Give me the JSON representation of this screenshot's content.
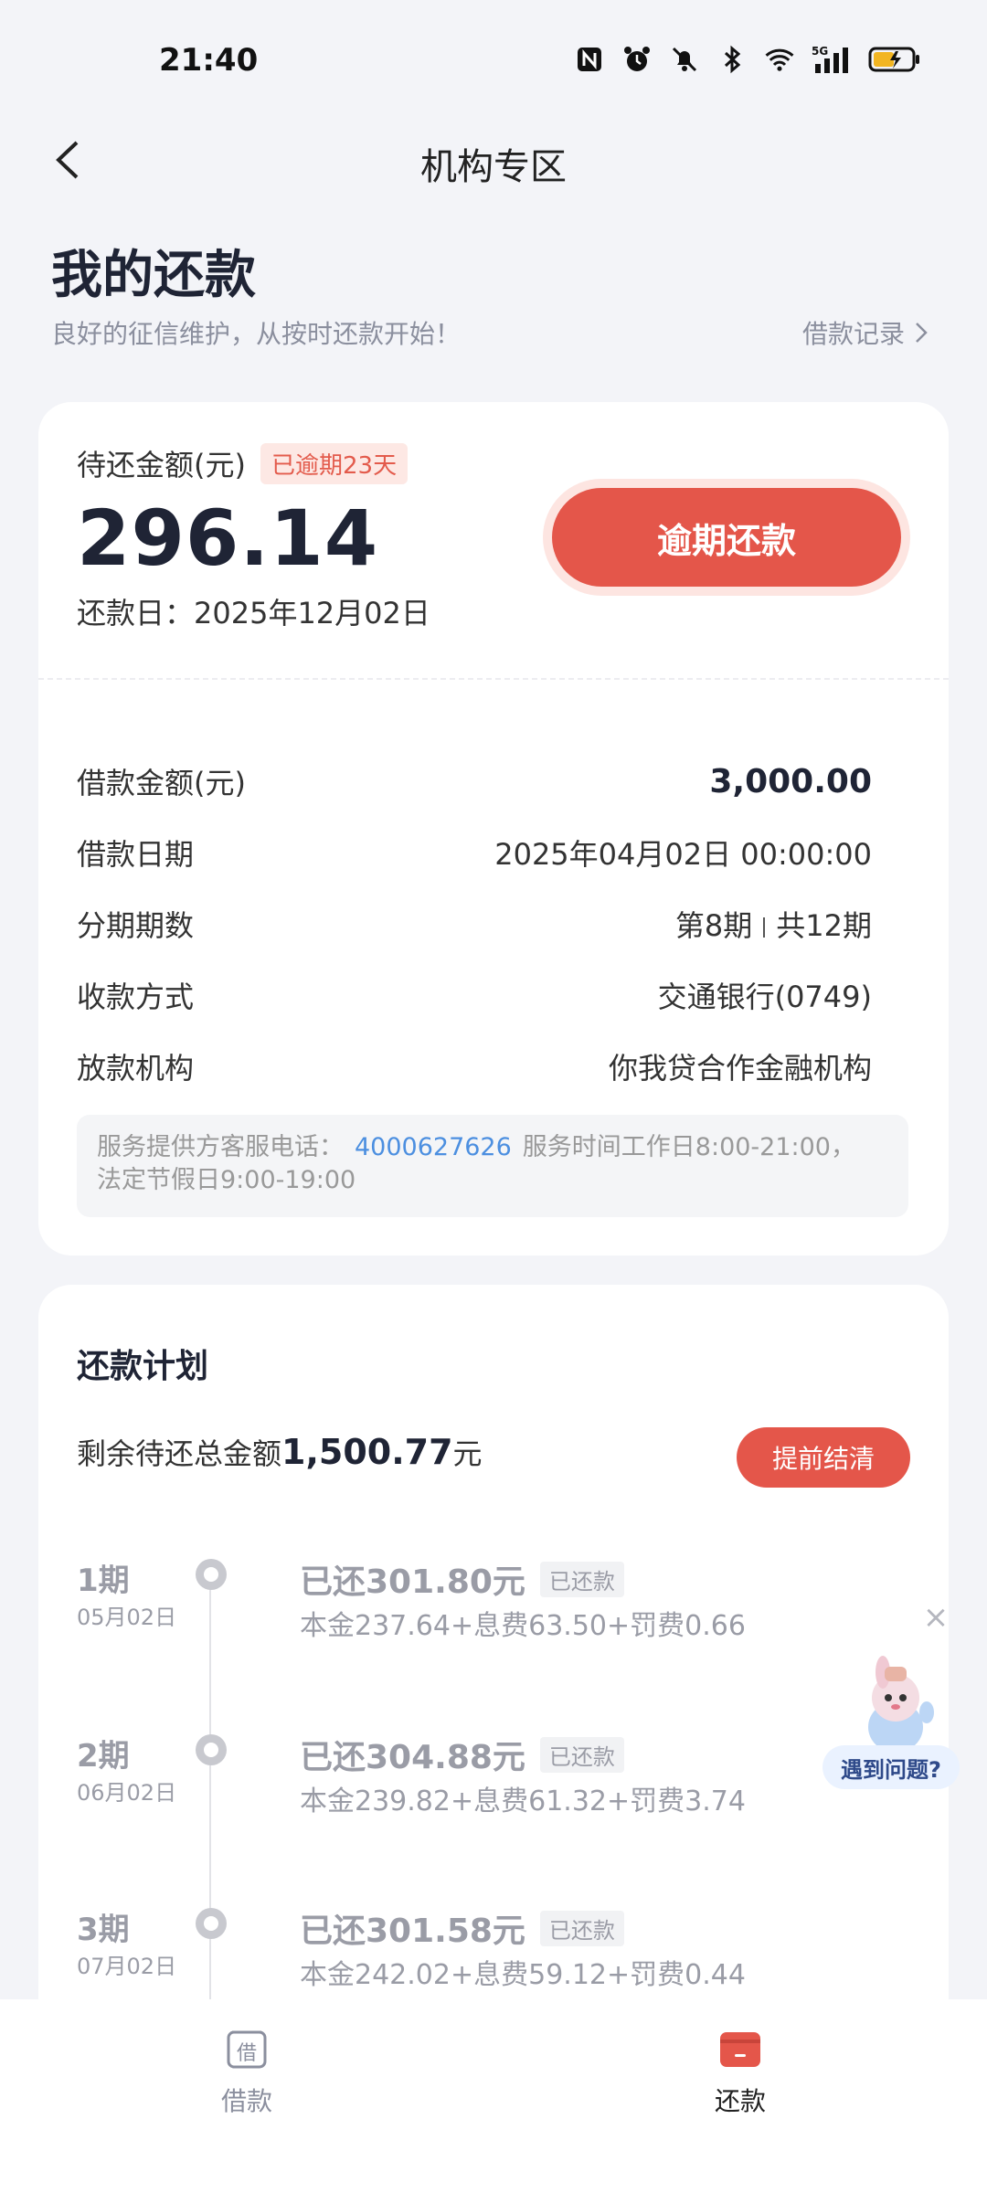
{
  "status_bar": {
    "time": "21:40",
    "network": "5G"
  },
  "header": {
    "title": "机构专区"
  },
  "page": {
    "title": "我的还款",
    "subtitle": "良好的征信维护，从按时还款开始！",
    "loan_records_link": "借款记录"
  },
  "summary": {
    "pending_label": "待还金额(元)",
    "overdue_badge": "已逾期23天",
    "pending_amount": "296.14",
    "due_date": "还款日：2025年12月02日",
    "overdue_button": "逾期还款"
  },
  "details": [
    {
      "label": "借款金额(元)",
      "value": "3,000.00"
    },
    {
      "label": "借款日期",
      "value": "2025年04月02日 00:00:00"
    },
    {
      "label": "分期期数",
      "value_current": "第8期",
      "value_total": "共12期"
    },
    {
      "label": "收款方式",
      "value": "交通银行(0749)"
    },
    {
      "label": "放款机构",
      "value": "你我贷合作金融机构"
    }
  ],
  "service": {
    "prefix": "服务提供方客服电话：",
    "phone": "4000627626",
    "hours": "服务时间工作日8:00-21:00，",
    "hours2": "法定节假日9:00-19:00"
  },
  "plan": {
    "title": "还款计划",
    "remaining_prefix": "剩余待还总金额",
    "remaining_amount": "1,500.77",
    "remaining_suffix": "元",
    "early_button": "提前结清",
    "periods": [
      {
        "num": "1期",
        "date": "05月02日",
        "paid": "已还301.80元",
        "tag": "已还款",
        "detail": "本金237.64+息费63.50+罚费0.66"
      },
      {
        "num": "2期",
        "date": "06月02日",
        "paid": "已还304.88元",
        "tag": "已还款",
        "detail": "本金239.82+息费61.32+罚费3.74"
      },
      {
        "num": "3期",
        "date": "07月02日",
        "paid": "已还301.58元",
        "tag": "已还款",
        "detail": "本金242.02+息费59.12+罚费0.44"
      }
    ]
  },
  "helper": {
    "label": "遇到问题?"
  },
  "tabbar": {
    "borrow": {
      "label": "借款",
      "icon_char": "借"
    },
    "repay": {
      "label": "还款"
    }
  },
  "colors": {
    "accent": "#e4564a",
    "link": "#4c8fe0"
  }
}
